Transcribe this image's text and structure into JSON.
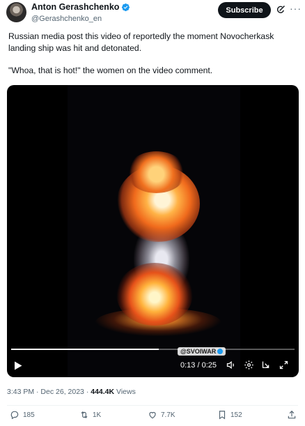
{
  "author": {
    "name": "Anton Gerashchenko",
    "handle": "@Gerashchenko_en"
  },
  "header": {
    "subscribe_label": "Subscribe"
  },
  "post": {
    "paragraph1": "Russian media post this video of reportedly the moment Novocherkask landing ship was hit and detonated.",
    "paragraph2": "\"Whoa, that is hot!\" the women on the video comment."
  },
  "video": {
    "watermark": "@SVOIWAR",
    "time": "0:13 / 0:25",
    "progress_fraction": 0.52
  },
  "meta": {
    "timestamp": "3:43 PM · Dec 26, 2023 · ",
    "views_count": "444.4K",
    "views_label": " Views"
  },
  "actions": {
    "replies": "185",
    "reposts": "1K",
    "likes": "7.7K",
    "bookmarks": "152"
  },
  "colors": {
    "text": "#0f1419",
    "secondary": "#536471",
    "verified": "#1d9bf0",
    "divider": "#eff3f4"
  }
}
